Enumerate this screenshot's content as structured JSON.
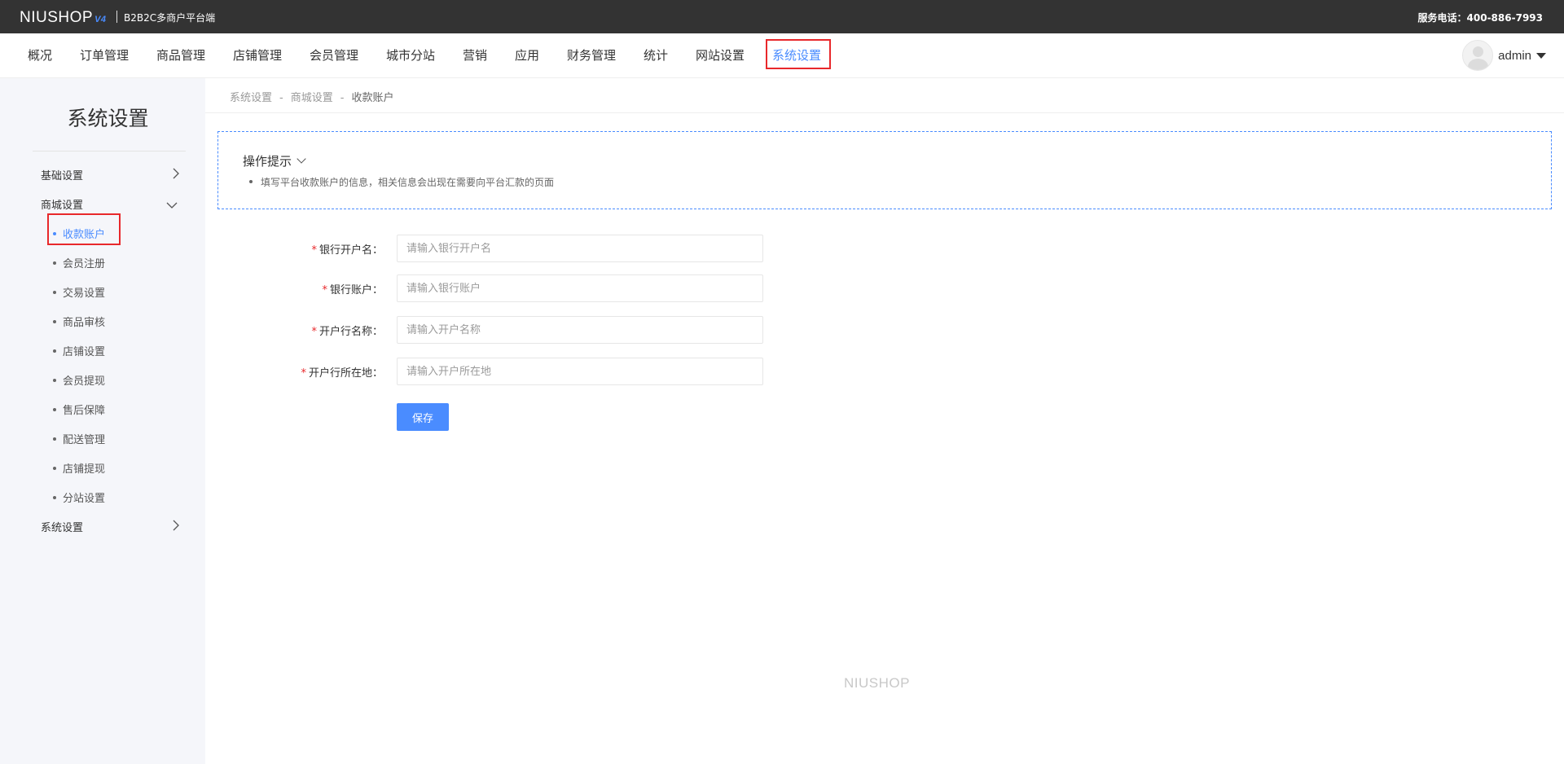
{
  "header": {
    "logo": "NIUSHOP",
    "logo_version": "V4",
    "platform": "B2B2C多商户平台端",
    "hotline": "服务电话：400-886-7993"
  },
  "nav": {
    "items": [
      {
        "label": "概况"
      },
      {
        "label": "订单管理"
      },
      {
        "label": "商品管理"
      },
      {
        "label": "店铺管理"
      },
      {
        "label": "会员管理"
      },
      {
        "label": "城市分站"
      },
      {
        "label": "营销"
      },
      {
        "label": "应用"
      },
      {
        "label": "财务管理"
      },
      {
        "label": "统计"
      },
      {
        "label": "网站设置"
      },
      {
        "label": "系统设置",
        "active": true
      }
    ],
    "username": "admin"
  },
  "sidebar": {
    "title": "系统设置",
    "groups": [
      {
        "label": "基础设置",
        "expanded": false
      },
      {
        "label": "商城设置",
        "expanded": true,
        "items": [
          {
            "label": "收款账户",
            "active": true
          },
          {
            "label": "会员注册"
          },
          {
            "label": "交易设置"
          },
          {
            "label": "商品审核"
          },
          {
            "label": "店铺设置"
          },
          {
            "label": "会员提现"
          },
          {
            "label": "售后保障"
          },
          {
            "label": "配送管理"
          },
          {
            "label": "店铺提现"
          },
          {
            "label": "分站设置"
          }
        ]
      },
      {
        "label": "系统设置",
        "expanded": false
      }
    ]
  },
  "breadcrumb": [
    "系统设置",
    "商城设置",
    "收款账户"
  ],
  "breadcrumb_sep": "-",
  "tips": {
    "title": "操作提示",
    "items": [
      "填写平台收款账户的信息，相关信息会出现在需要向平台汇款的页面"
    ]
  },
  "form": {
    "required_mark": "*",
    "fields": [
      {
        "label": "银行开户名：",
        "placeholder": "请输入银行开户名",
        "value": ""
      },
      {
        "label": "银行账户：",
        "placeholder": "请输入银行账户",
        "value": ""
      },
      {
        "label": "开户行名称：",
        "placeholder": "请输入开户名称",
        "value": ""
      },
      {
        "label": "开户行所在地：",
        "placeholder": "请输入开户所在地",
        "value": ""
      }
    ],
    "save_label": "保存"
  },
  "footer": {
    "logo": "NIUSHOP"
  },
  "colors": {
    "accent": "#4a8cff",
    "topbar": "#333333",
    "highlight_border": "#e8282b",
    "sidebar_bg": "#f5f6fa"
  }
}
